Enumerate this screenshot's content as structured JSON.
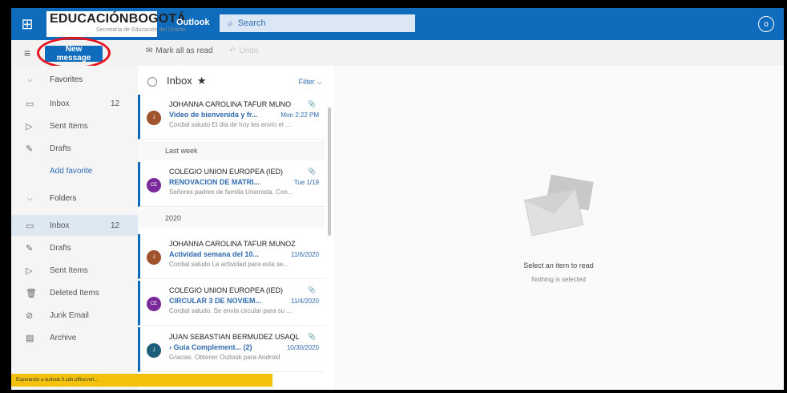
{
  "topbar": {
    "logo_main": "EDUCACIÓNBOGOTÁ",
    "logo_sub": "Secretaría de Educación del Distrito",
    "app_name": "Outlook",
    "search_placeholder": "Search",
    "apps_icon": "grid-icon",
    "avatar_label": "o"
  },
  "commands": {
    "new_message": "New message",
    "mark_all_read": "Mark all as read",
    "undo": "Undo"
  },
  "nav": {
    "favorites_header": "Favorites",
    "favorites": [
      {
        "label": "Inbox",
        "count": "12"
      },
      {
        "label": "Sent Items",
        "count": ""
      },
      {
        "label": "Drafts",
        "count": ""
      }
    ],
    "add_favorite": "Add favorite",
    "folders_header": "Folders",
    "folders": [
      {
        "label": "Inbox",
        "count": "12"
      },
      {
        "label": "Drafts",
        "count": ""
      },
      {
        "label": "Sent Items",
        "count": ""
      },
      {
        "label": "Deleted Items",
        "count": ""
      },
      {
        "label": "Junk Email",
        "count": ""
      },
      {
        "label": "Archive",
        "count": ""
      }
    ]
  },
  "list": {
    "title": "Inbox",
    "filter": "Filter",
    "sections": [
      "Last week",
      "2020"
    ],
    "emails": [
      {
        "initials": "J",
        "color": "#a0522d",
        "sender": "JOHANNA CAROLINA TAFUR MUNO",
        "subject": "Video de bienvenida y fr...",
        "time": "Mon 2:22 PM",
        "preview": "Cordial saludo El día de hoy les envío el ..."
      },
      {
        "initials": "CE",
        "color": "#7b2a9c",
        "sender": "COLEGIO UNION EUROPEA (IED)",
        "subject": "RENOVACION DE MATRI...",
        "time": "Tue 1/19",
        "preview": "Señores padres de familia Unionista. Con..."
      },
      {
        "initials": "J",
        "color": "#a0522d",
        "sender": "JOHANNA CAROLINA TAFUR MUNOZ",
        "subject": "Actividad semana del 10...",
        "time": "11/6/2020",
        "preview": "Cordial saludo La actividad para esta se..."
      },
      {
        "initials": "CE",
        "color": "#7b2a9c",
        "sender": "COLEGIO UNION EUROPEA (IED)",
        "subject": "CIRCULAR 3 DE NOVIEM...",
        "time": "11/4/2020",
        "preview": "Cordial saludo. Se envía circular para su ..."
      },
      {
        "initials": "J",
        "color": "#1b5e7a",
        "sender": "JUAN SEBASTIAN BERMUDEZ USAQL",
        "subject": "› Guia Complement... (2)",
        "time": "10/30/2020",
        "preview": "Gracias. Obtener Outlook para Android"
      }
    ]
  },
  "reading": {
    "title": "Select an item to read",
    "subtitle": "Nothing is selected"
  },
  "status": {
    "text": "Esperando a outlook.0.cdn.office.net..."
  }
}
